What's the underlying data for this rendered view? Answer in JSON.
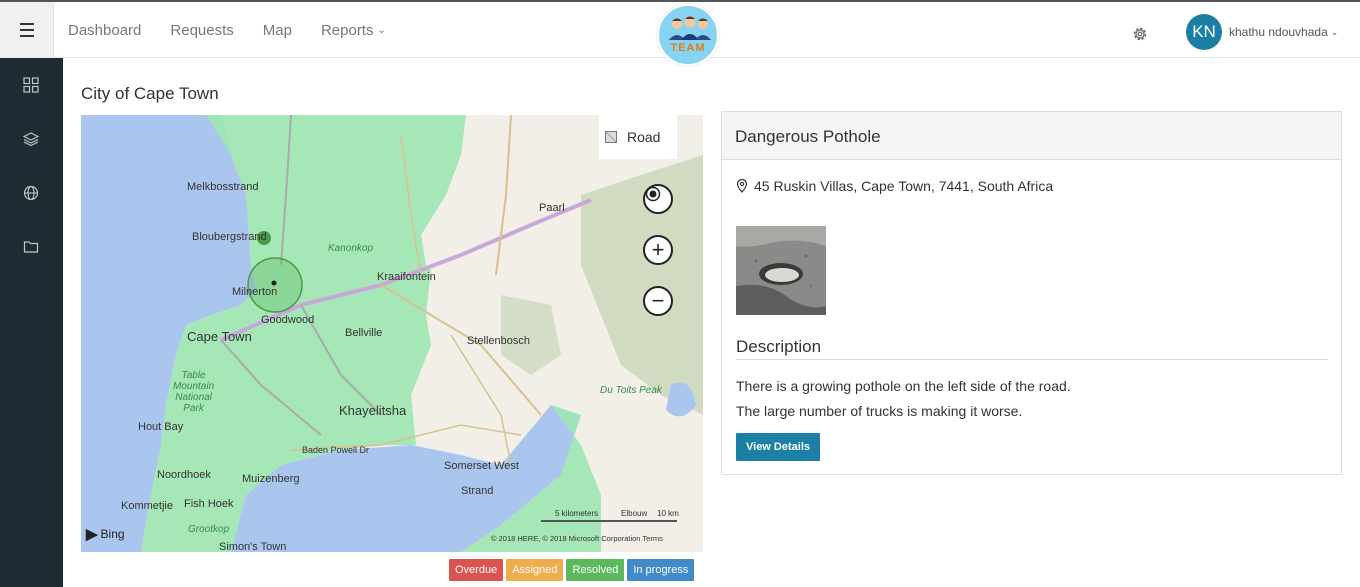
{
  "nav": {
    "items": [
      {
        "label": "Dashboard"
      },
      {
        "label": "Requests"
      },
      {
        "label": "Map"
      },
      {
        "label": "Reports"
      }
    ]
  },
  "logo": {
    "text": "TEAM"
  },
  "user": {
    "initials": "KN",
    "name": "khathu ndouvhada"
  },
  "sidebar": {
    "icons": [
      "dashboard-icon",
      "layers-icon",
      "globe-icon",
      "folder-icon"
    ]
  },
  "page": {
    "title": "City of Cape Town"
  },
  "map": {
    "style_label": "Road",
    "labels": {
      "melkbosstrand": "Melkbosstrand",
      "bloubergstrand": "Bloubergstrand",
      "milnerton": "Milnerton",
      "goodwood": "Goodwood",
      "cape_town": "Cape Town",
      "bellville": "Bellville",
      "kraaifontein": "Kraaifontein",
      "paarl": "Paarl",
      "stellenbosch": "Stellenbosch",
      "khayelitsha": "Khayelitsha",
      "hout_bay": "Hout Bay",
      "noordhoek": "Noordhoek",
      "kommetjie": "Kommetjie",
      "fish_hoek": "Fish Hoek",
      "muizenberg": "Muizenberg",
      "simons_town": "Simon's Town",
      "somerset_west": "Somerset West",
      "strand": "Strand",
      "kanonkop": "Kanonkop",
      "du_toits_peak": "Du Toits Peak",
      "table_mountain": "Table\nMountain\nNational\nPark",
      "baden_powell": "Baden Powell Dr",
      "grootkop": "Grootkop",
      "elgin": "Elbouw"
    },
    "scale_left": "5 kilometers",
    "scale_right": "10 km",
    "bing": "Bing",
    "copyright": "© 2018 HERE, © 2018 Microsoft Corporation  Terms"
  },
  "legend": [
    {
      "label": "Overdue",
      "color": "#d9534f"
    },
    {
      "label": "Assigned",
      "color": "#f0ad4e"
    },
    {
      "label": "Resolved",
      "color": "#5cb85c"
    },
    {
      "label": "In progress",
      "color": "#428bca"
    }
  ],
  "detail": {
    "title": "Dangerous Pothole",
    "address": "45 Ruskin Villas, Cape Town, 7441, South Africa",
    "description_heading": "Description",
    "description_lines": [
      "There is a growing pothole on the left side of the road.",
      "The large number of trucks is making it worse."
    ],
    "button_label": "View Details"
  }
}
